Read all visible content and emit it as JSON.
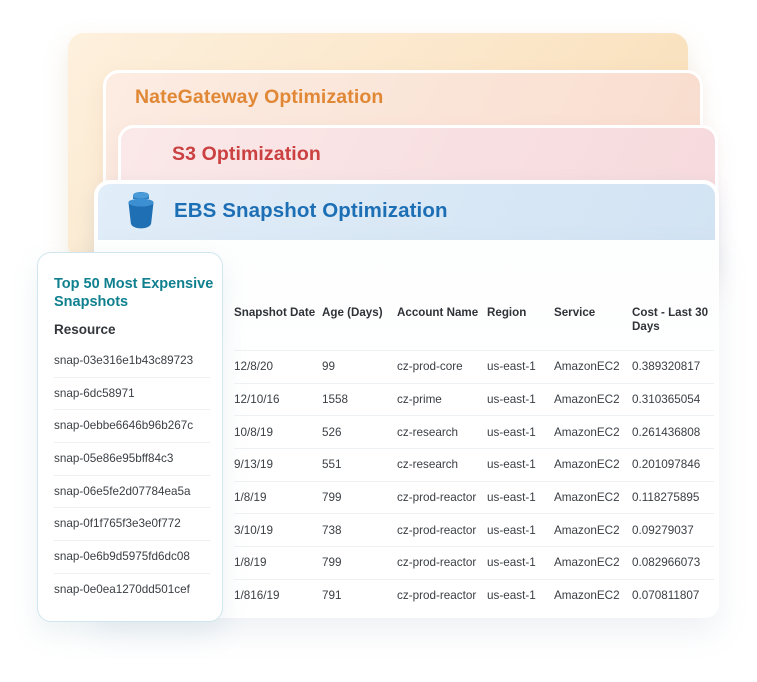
{
  "cards": [
    {
      "id": "nategateway",
      "label": "NateGateway Optimization",
      "color": "#e08836"
    },
    {
      "id": "s3",
      "label": "S3 Optimization",
      "color": "#cb4040"
    },
    {
      "id": "ebs",
      "label": "EBS Snapshot Optimization",
      "color": "#1d6fb5",
      "icon": "trash-icon"
    }
  ],
  "panel": {
    "title": "Top 50 Most Expensive Snapshots",
    "resource_header": "Resource",
    "accent_color": "#10808f"
  },
  "table": {
    "columns": [
      "Snapshot Date",
      "Age (Days)",
      "Account Name",
      "Region",
      "Service",
      "Cost - Last 30 Days"
    ],
    "rows": [
      {
        "resource": "snap-03e316e1b43c89723",
        "snapshot_date": "12/8/20",
        "age_days": "99",
        "account_name": "cz-prod-core",
        "region": "us-east-1",
        "service": "AmazonEC2",
        "cost_last_30_days": "0.389320817"
      },
      {
        "resource": "snap-6dc58971",
        "snapshot_date": "12/10/16",
        "age_days": "1558",
        "account_name": "cz-prime",
        "region": "us-east-1",
        "service": "AmazonEC2",
        "cost_last_30_days": "0.310365054"
      },
      {
        "resource": "snap-0ebbe6646b96b267c",
        "snapshot_date": "10/8/19",
        "age_days": "526",
        "account_name": "cz-research",
        "region": "us-east-1",
        "service": "AmazonEC2",
        "cost_last_30_days": "0.261436808"
      },
      {
        "resource": "snap-05e86e95bff84c3",
        "snapshot_date": "9/13/19",
        "age_days": "551",
        "account_name": "cz-research",
        "region": "us-east-1",
        "service": "AmazonEC2",
        "cost_last_30_days": "0.201097846"
      },
      {
        "resource": "snap-06e5fe2d07784ea5a",
        "snapshot_date": "1/8/19",
        "age_days": "799",
        "account_name": "cz-prod-reactor",
        "region": "us-east-1",
        "service": "AmazonEC2",
        "cost_last_30_days": "0.118275895"
      },
      {
        "resource": "snap-0f1f765f3e3e0f772",
        "snapshot_date": "3/10/19",
        "age_days": "738",
        "account_name": "cz-prod-reactor",
        "region": "us-east-1",
        "service": "AmazonEC2",
        "cost_last_30_days": "0.09279037"
      },
      {
        "resource": "snap-0e6b9d5975fd6dc08",
        "snapshot_date": "1/8/19",
        "age_days": "799",
        "account_name": "cz-prod-reactor",
        "region": "us-east-1",
        "service": "AmazonEC2",
        "cost_last_30_days": "0.082966073"
      },
      {
        "resource": "snap-0e0ea1270dd501cef",
        "snapshot_date": "1/816/19",
        "age_days": "791",
        "account_name": "cz-prod-reactor",
        "region": "us-east-1",
        "service": "AmazonEC2",
        "cost_last_30_days": "0.070811807"
      }
    ]
  }
}
